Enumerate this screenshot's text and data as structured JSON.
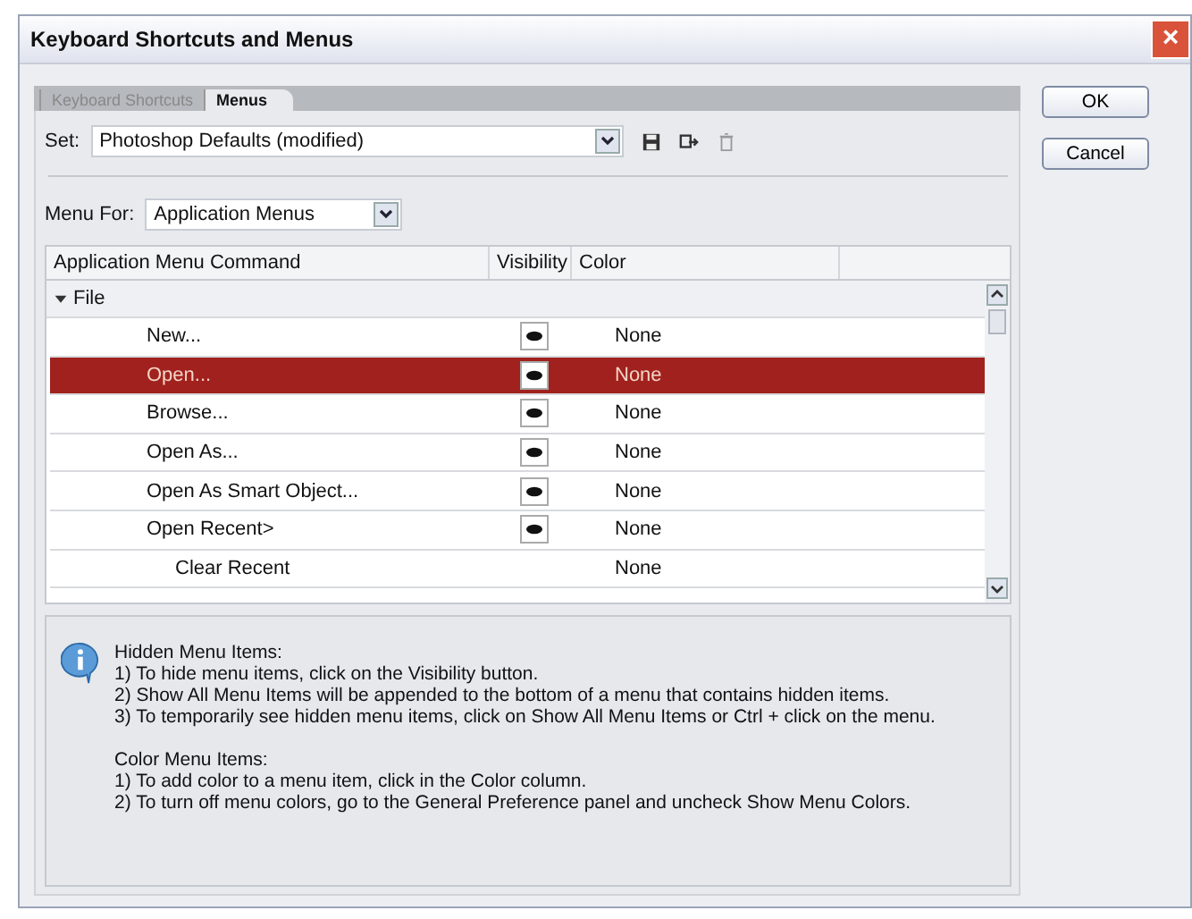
{
  "window": {
    "title": "Keyboard Shortcuts and Menus",
    "close": "×"
  },
  "tabs": [
    {
      "label": "Keyboard Shortcuts",
      "selected": false
    },
    {
      "label": "Menus",
      "selected": true
    }
  ],
  "set": {
    "label": "Set:",
    "value": "Photoshop Defaults (modified)"
  },
  "menu_for": {
    "label": "Menu For:",
    "value": "Application Menus"
  },
  "table": {
    "columns": [
      "Application Menu Command",
      "Visibility",
      "Color"
    ],
    "groups": [
      {
        "name": "File",
        "expanded": true,
        "children": [
          {
            "name": "New...",
            "visibility_button": true,
            "color_text": "None",
            "selected": false
          },
          {
            "name": "Open...",
            "visibility_button": true,
            "color_text": "None",
            "selected": true
          },
          {
            "name": "Browse...",
            "visibility_button": true,
            "color_text": "None",
            "selected": false
          },
          {
            "name": "Open As...",
            "visibility_button": true,
            "color_text": "None",
            "selected": false
          },
          {
            "name": "Open As Smart Object...",
            "visibility_button": true,
            "color_text": "None",
            "selected": false
          },
          {
            "name": "Open Recent>",
            "visibility_button": true,
            "color_text": "None",
            "selected": false,
            "children": [
              {
                "name": "Clear Recent",
                "visibility_button": false,
                "color_text": "None",
                "selected": false
              }
            ]
          }
        ]
      }
    ]
  },
  "info": {
    "sections": [
      {
        "title": "Hidden Menu Items:",
        "lines": [
          "1) To hide menu items, click on the Visibility button.",
          "2) Show All Menu Items will be appended to the bottom of a menu that contains hidden items.",
          "3) To temporarily see hidden menu items, click on Show All Menu Items or Ctrl + click on the menu."
        ]
      },
      {
        "title": "Color Menu Items:",
        "lines": [
          "1) To add color to a menu item, click in the Color column.",
          "2) To turn off menu colors, go to the General Preference panel and uncheck Show Menu Colors."
        ]
      }
    ]
  },
  "buttons": [
    "OK",
    "Cancel"
  ]
}
